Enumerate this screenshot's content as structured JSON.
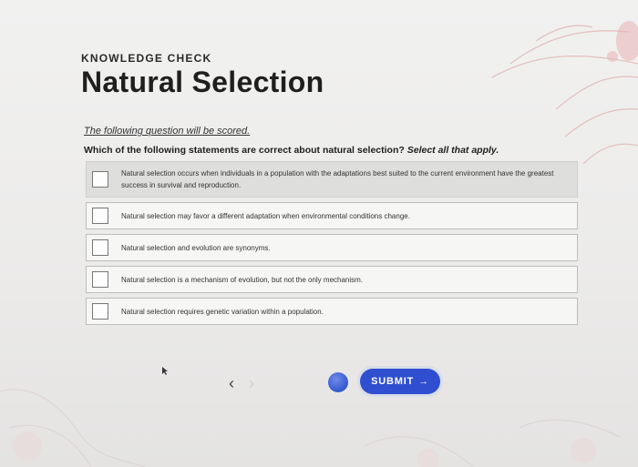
{
  "header": {
    "kicker": "KNOWLEDGE CHECK",
    "title": "Natural Selection"
  },
  "instructions": {
    "scored_note": "The following question will be scored.",
    "question": "Which of the following statements are correct about natural selection?",
    "question_hint": "Select all that apply."
  },
  "options": [
    {
      "text": "Natural selection occurs when individuals in a population with the adaptations best suited to the current environment have the greatest success in survival and reproduction.",
      "highlighted": true,
      "checked": false
    },
    {
      "text": "Natural selection may favor a different adaptation when environmental conditions change.",
      "highlighted": false,
      "checked": false
    },
    {
      "text": "Natural selection and evolution are synonyms.",
      "highlighted": false,
      "checked": false
    },
    {
      "text": "Natural selection is a mechanism of evolution, but not the only mechanism.",
      "highlighted": false,
      "checked": false
    },
    {
      "text": "Natural selection requires genetic variation within a population.",
      "highlighted": false,
      "checked": false
    }
  ],
  "nav": {
    "prev_icon": "‹",
    "next_icon": "›",
    "submit_label": "SUBMIT",
    "submit_icon": "→"
  },
  "colors": {
    "accent": "#2f4ed0",
    "selected_row": "#dededd",
    "decor_pink": "#e7bdbf"
  }
}
